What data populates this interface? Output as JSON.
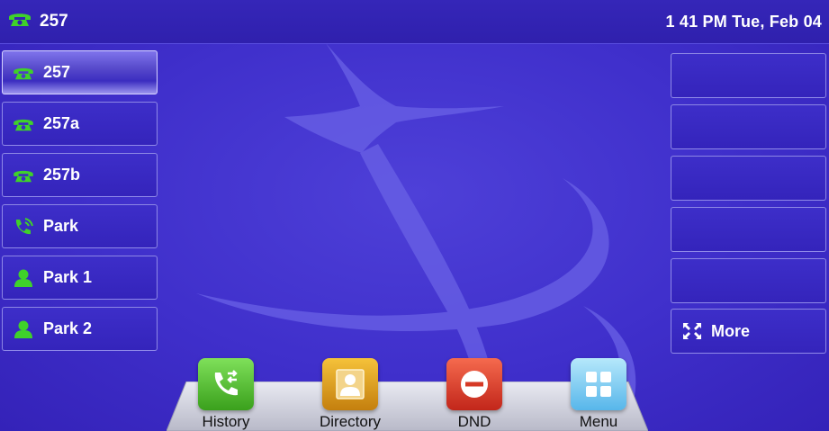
{
  "status_bar": {
    "account": "257",
    "datetime": "1 41 PM Tue, Feb 04"
  },
  "line_keys": [
    {
      "label": "257",
      "icon": "phone-icon",
      "active": true
    },
    {
      "label": "257a",
      "icon": "phone-icon",
      "active": false
    },
    {
      "label": "257b",
      "icon": "phone-icon",
      "active": false
    },
    {
      "label": "Park",
      "icon": "call-park-icon",
      "active": false
    },
    {
      "label": "Park 1",
      "icon": "contact-icon",
      "active": false
    },
    {
      "label": "Park 2",
      "icon": "contact-icon",
      "active": false
    }
  ],
  "dss_keys": [
    {
      "label": ""
    },
    {
      "label": ""
    },
    {
      "label": ""
    },
    {
      "label": ""
    },
    {
      "label": ""
    },
    {
      "label": "More",
      "icon": "expand-icon"
    }
  ],
  "dock": {
    "history": {
      "label": "History",
      "icon": "history-icon"
    },
    "directory": {
      "label": "Directory",
      "icon": "directory-icon"
    },
    "dnd": {
      "label": "DND",
      "icon": "dnd-icon"
    },
    "menu": {
      "label": "Menu",
      "icon": "menu-grid-icon"
    }
  },
  "colors": {
    "background": "#3f2fcb",
    "accent_green": "#3fd12a",
    "text": "#ffffff"
  }
}
